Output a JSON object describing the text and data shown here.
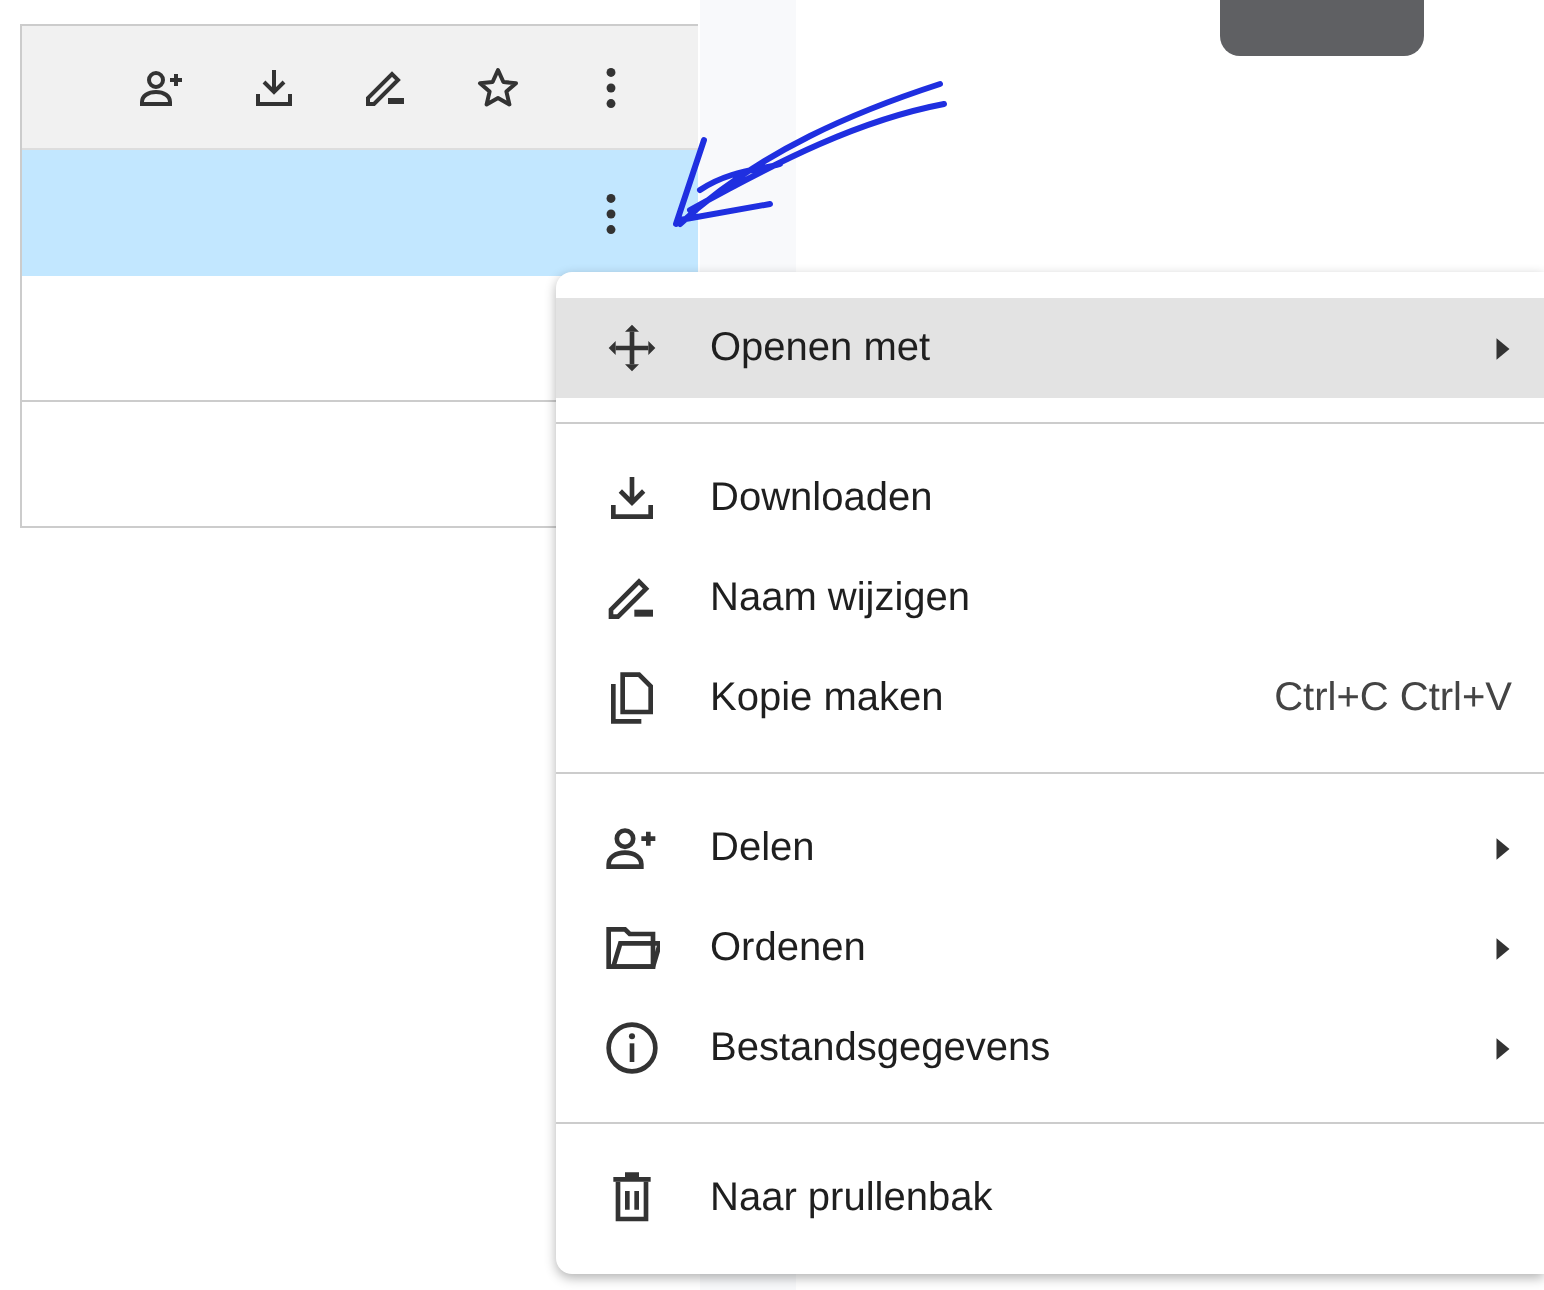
{
  "file_rows": [
    {
      "selected": true
    },
    {
      "selected": false
    },
    {
      "selected": false
    }
  ],
  "context_menu": {
    "groups": [
      [
        {
          "label": "Openen met",
          "submenu": true,
          "selected": true
        }
      ],
      [
        {
          "label": "Downloaden",
          "submenu": false,
          "selected": false
        },
        {
          "label": "Naam wijzigen",
          "submenu": false,
          "selected": false
        },
        {
          "label": "Kopie maken",
          "shortcut": "Ctrl+C Ctrl+V",
          "submenu": false,
          "selected": false
        }
      ],
      [
        {
          "label": "Delen",
          "submenu": true,
          "selected": false
        },
        {
          "label": "Ordenen",
          "submenu": true,
          "selected": false
        },
        {
          "label": "Bestandsgegevens",
          "submenu": true,
          "selected": false
        }
      ],
      [
        {
          "label": "Naar prullenbak",
          "submenu": false,
          "selected": false
        }
      ]
    ]
  }
}
